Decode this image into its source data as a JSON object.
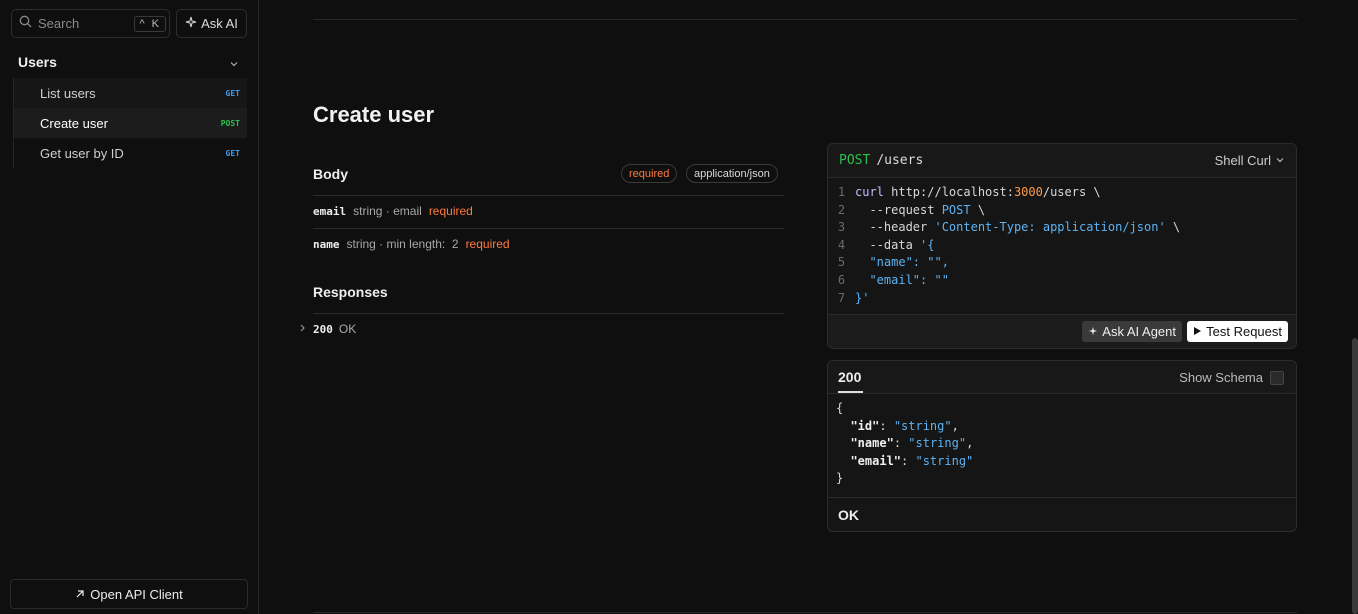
{
  "sidebar": {
    "search_placeholder": "Search",
    "search_shortcut": "^ K",
    "ask_ai_label": "Ask AI",
    "group_label": "Users",
    "items": [
      {
        "label": "List users",
        "method": "GET"
      },
      {
        "label": "Create user",
        "method": "POST"
      },
      {
        "label": "Get user by ID",
        "method": "GET"
      }
    ],
    "open_api_client_label": "Open API Client"
  },
  "endpoint": {
    "title": "Create user",
    "body_heading": "Body",
    "required_pill": "required",
    "content_type_pill": "application/json",
    "params": [
      {
        "name": "email",
        "type": "string · email",
        "required": "required"
      },
      {
        "name": "name",
        "type": "string · min length:  2",
        "required": "required"
      }
    ],
    "responses_heading": "Responses",
    "responses": [
      {
        "code": "200",
        "text": "OK"
      }
    ]
  },
  "request_card": {
    "method": "POST",
    "path": "/users",
    "language": "Shell Curl",
    "line_numbers": [
      "1",
      "2",
      "3",
      "4",
      "5",
      "6",
      "7"
    ],
    "code": {
      "l1_cmd": "curl",
      "l1_url_a": " http://localhost:",
      "l1_port": "3000",
      "l1_url_b": "/users \\",
      "l2_flag": "  --request ",
      "l2_val": "POST",
      "l2_tail": " \\",
      "l3_flag": "  --header ",
      "l3_val": "'Content-Type: application/json'",
      "l3_tail": " \\",
      "l4_flag": "  --data ",
      "l4_val": "'{",
      "l5": "  \"name\": \"\",",
      "l6": "  \"email\": \"\"",
      "l7": "}'"
    },
    "ask_agent_label": "Ask AI Agent",
    "test_request_label": "Test Request"
  },
  "response_card": {
    "tab_label": "200",
    "show_schema_label": "Show Schema",
    "json": {
      "open": "{",
      "k1": "\"id\"",
      "v1": "\"string\"",
      "k2": "\"name\"",
      "v2": "\"string\"",
      "k3": "\"email\"",
      "v3": "\"string\"",
      "close": "}"
    },
    "status_text": "OK"
  },
  "colors": {
    "get": "#3b9cf0",
    "post": "#2fbf4f",
    "required": "#ff7a3d",
    "background": "#0f0f0f"
  }
}
